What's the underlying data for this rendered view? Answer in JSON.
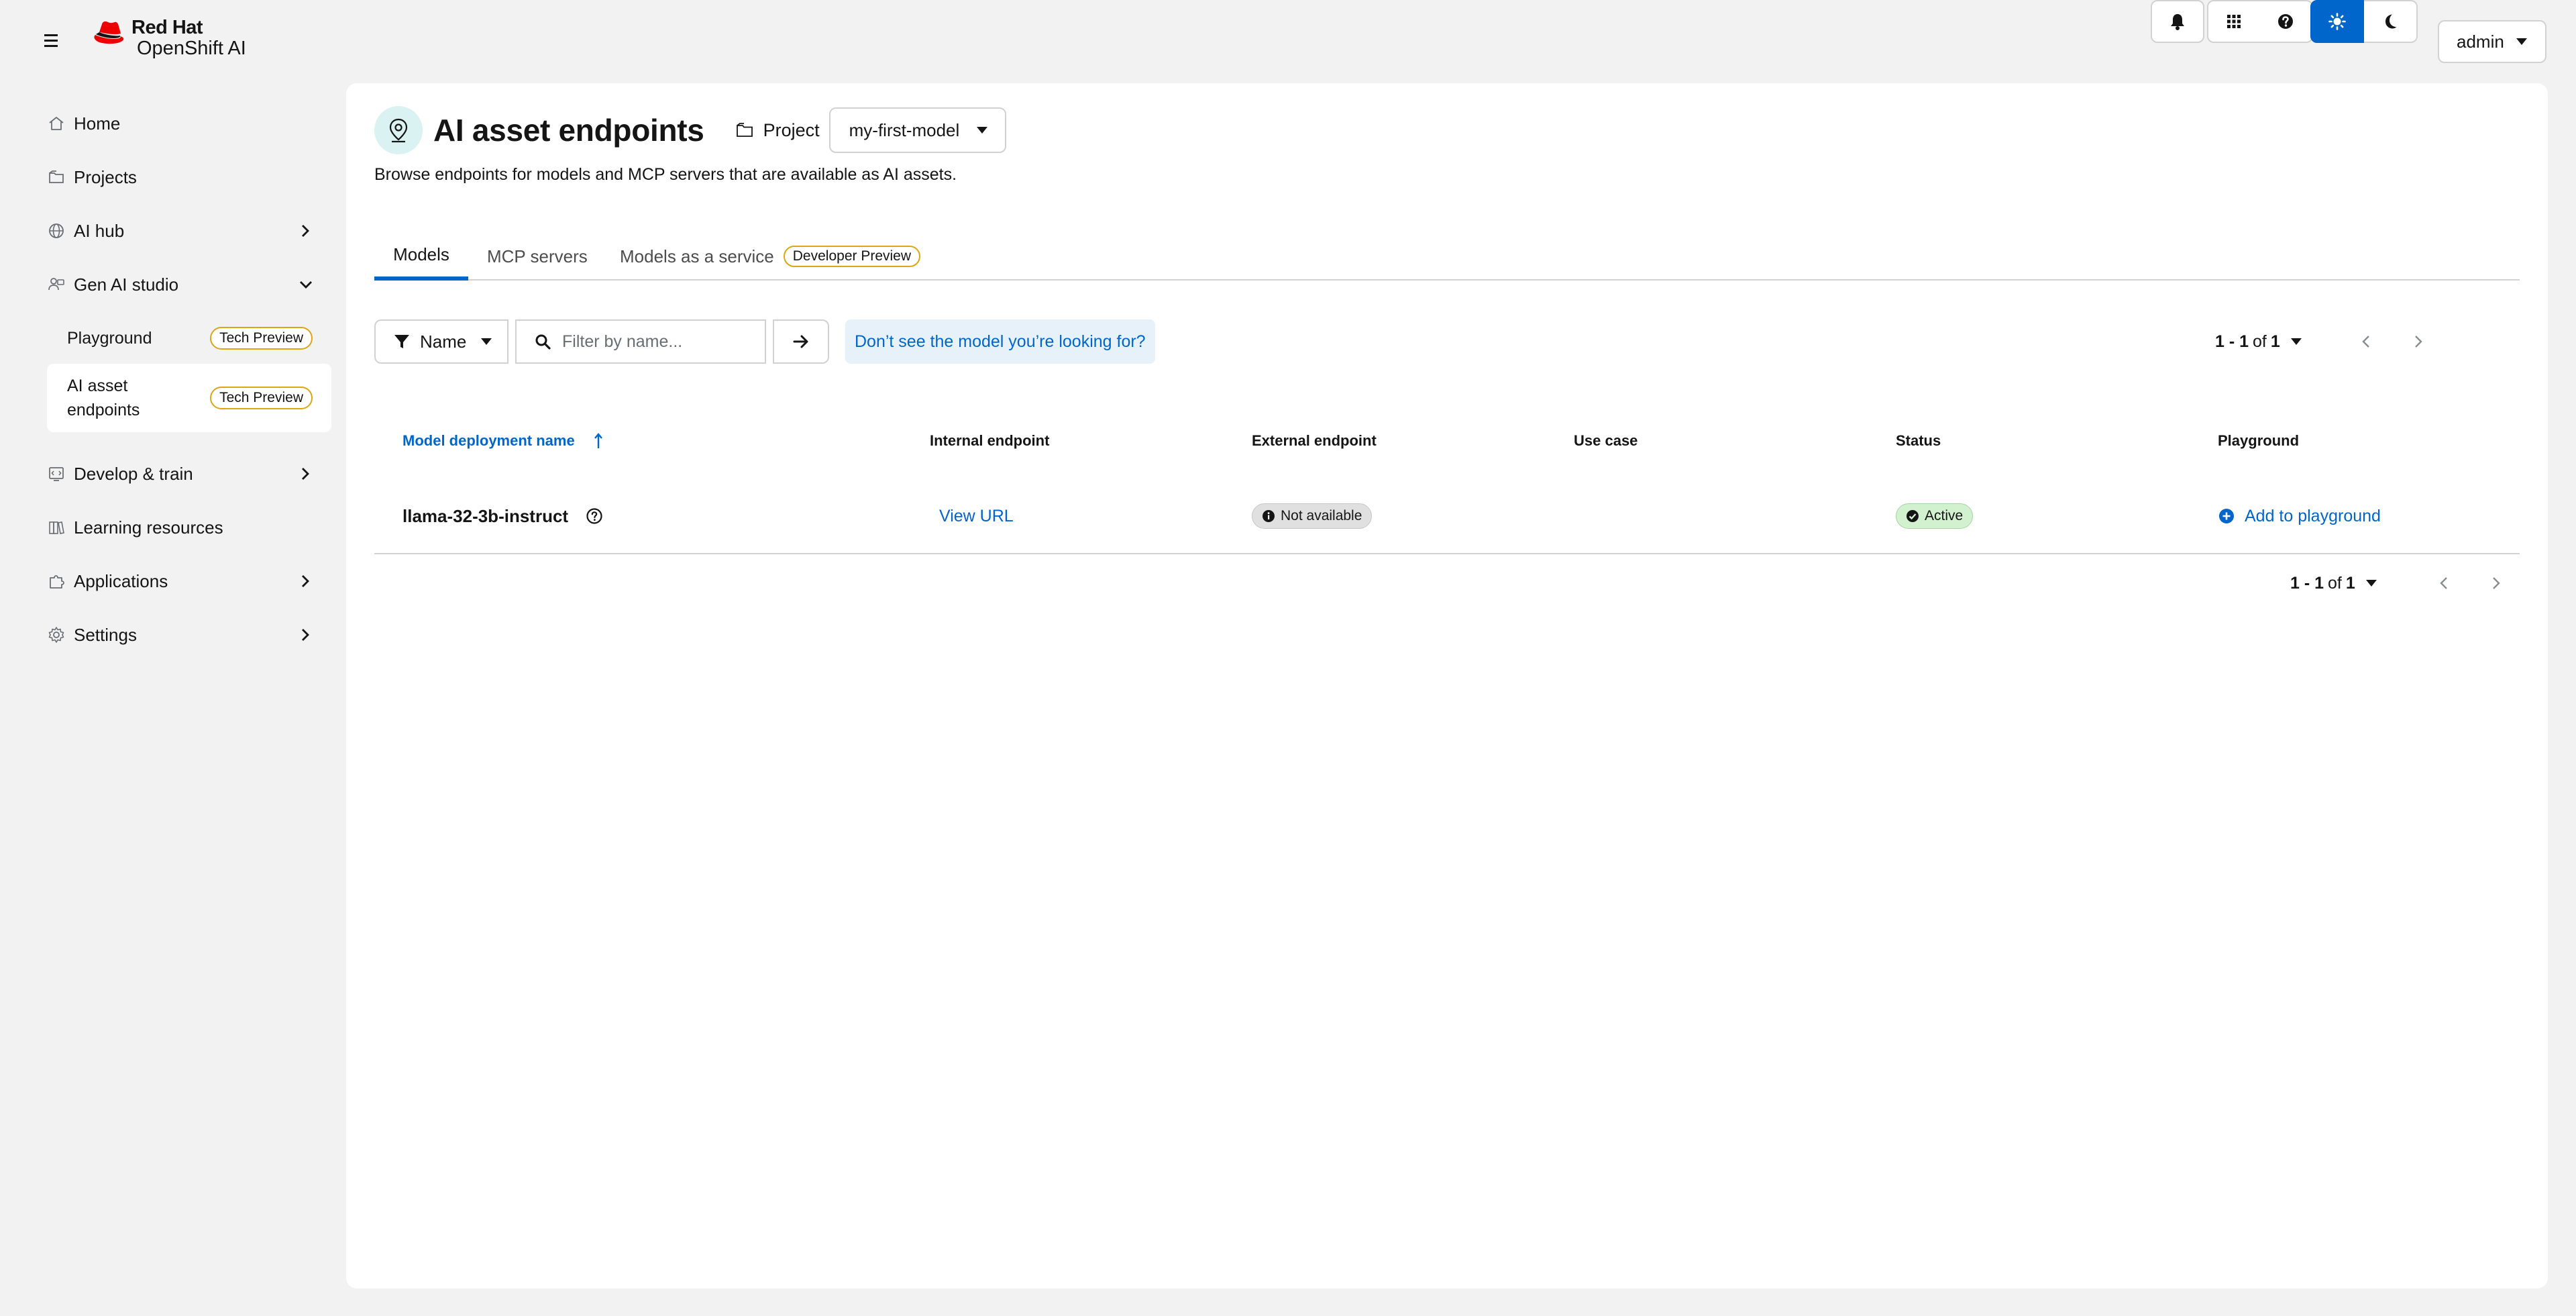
{
  "brand": {
    "line1": "Red Hat",
    "line2": "OpenShift AI"
  },
  "masthead": {
    "user": "admin"
  },
  "sidebar": {
    "items": [
      {
        "label": "Home"
      },
      {
        "label": "Projects"
      },
      {
        "label": "AI hub"
      },
      {
        "label": "Gen AI studio"
      },
      {
        "label": "Develop & train"
      },
      {
        "label": "Learning resources"
      },
      {
        "label": "Applications"
      },
      {
        "label": "Settings"
      }
    ],
    "gen_ai_children": [
      {
        "label": "Playground",
        "badge": "Tech Preview"
      },
      {
        "label": "AI asset endpoints",
        "badge": "Tech Preview"
      }
    ]
  },
  "page": {
    "title": "AI asset endpoints",
    "project_label": "Project",
    "project_value": "my-first-model",
    "description": "Browse endpoints for models and MCP servers that are available as AI assets."
  },
  "tabs": [
    {
      "label": "Models"
    },
    {
      "label": "MCP servers"
    },
    {
      "label": "Models as a service",
      "badge": "Developer Preview"
    }
  ],
  "filter": {
    "type": "Name",
    "placeholder": "Filter by name...",
    "help_link": "Don’t see the model you’re looking for?"
  },
  "pagination": {
    "range": "1 - 1",
    "of": "of",
    "total": "1"
  },
  "table": {
    "headers": [
      "Model deployment name",
      "Internal endpoint",
      "External endpoint",
      "Use case",
      "Status",
      "Playground"
    ],
    "rows": [
      {
        "name": "llama-32-3b-instruct",
        "internal": "View URL",
        "external": "Not available",
        "use_case": "",
        "status": "Active",
        "playground": "Add to playground"
      }
    ]
  },
  "colors": {
    "accent": "#0066cc",
    "tech_preview_border": "#dca614",
    "active_bg": "#d1f1cf",
    "page_icon_bg": "#daf2f2"
  }
}
